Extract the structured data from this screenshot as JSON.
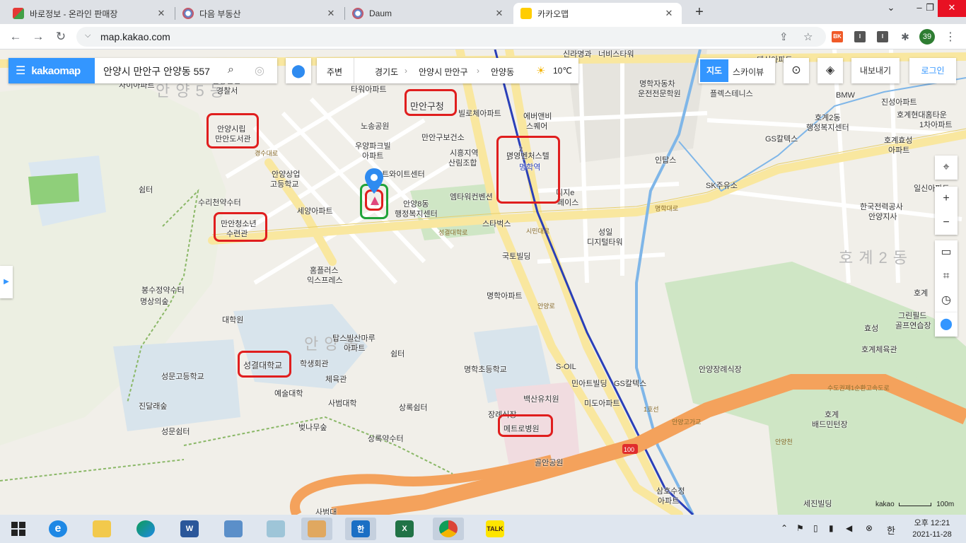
{
  "browser": {
    "tabs": [
      {
        "label": "바로정보 - 온라인 판매장",
        "close": "✕"
      },
      {
        "label": "다음 부동산",
        "close": "✕"
      },
      {
        "label": "Daum",
        "close": "✕"
      },
      {
        "label": "카카오맵",
        "close": "✕"
      }
    ],
    "new_tab": "+",
    "url": "map.kakao.com",
    "profile_badge": "39",
    "extensions": [
      "BK",
      "I",
      "I"
    ]
  },
  "mapui": {
    "brand": "kakaomap",
    "search_query": "안양시 만안구 안양동 557",
    "nearby_label": "주변",
    "breadcrumb": [
      "경기도",
      "안양시 만안구",
      "안양동"
    ],
    "temperature": "10℃",
    "maptype_map": "지도",
    "maptype_sky": "스카이뷰",
    "export_label": "내보내기",
    "login_label": "로그인",
    "scale_label": "kakao",
    "scale_distance": "100m",
    "icons": [
      "menu-icon",
      "search-icon",
      "check-icon",
      "location-pin-icon",
      "sun-icon",
      "layers-icon",
      "crosshair-icon",
      "zoom-in-icon",
      "zoom-out-icon",
      "ruler-icon",
      "area-icon",
      "compass-icon"
    ]
  },
  "map_labels": {
    "districts": [
      "안양5동",
      "안양동",
      "호계2동"
    ],
    "places": [
      "신라명과",
      "너비스타워",
      "대신아파트",
      "자이아파트",
      "안양만안",
      "경찰서",
      "명학자동차",
      "운전전문학원",
      "플렉스테니스",
      "BMW",
      "진성아파트",
      "만안구청",
      "안양시립",
      "만안도서관",
      "빌로체아파트",
      "노송공원",
      "타워아파트",
      "에버앤비",
      "스퀘어",
      "호계2동",
      "행정복지센터",
      "호계현대홈타운",
      "1차아파트",
      "만안구보건소",
      "시흥지역",
      "산림조합",
      "우양파크빌",
      "아파트",
      "GS칼텍스",
      "호계효성",
      "아파트",
      "명영벤처스텔",
      "인탑스",
      "안양상업",
      "고등학교",
      "쉼터",
      "SK주유소",
      "일신아파트",
      "수리천약수터",
      "트와이트센터",
      "디지e",
      "페이스",
      "안양8동",
      "행정복지센터",
      "엠타워컨벤션",
      "한국전력공사",
      "안양지사",
      "만안청소년",
      "수련관",
      "세양아파트",
      "스타벅스",
      "성일",
      "디지털타워",
      "국토빌딩",
      "홈플러스",
      "익스프레스",
      "봉수정약수터",
      "명상의숲",
      "명학아파트",
      "호계",
      "대학원",
      "탑스빌산마루",
      "아파트",
      "쉼터",
      "효성",
      "그린필드",
      "골프연습장",
      "호계체육관",
      "성결대학교",
      "학생회관",
      "성문고등학교",
      "명학초등학교",
      "S-OIL",
      "안양장례식장",
      "체육관",
      "예술대학",
      "민아트빌딩",
      "GS칼텍스",
      "백산유치원",
      "미도아파트",
      "진달래숲",
      "사범대학",
      "상록쉼터",
      "장례식장",
      "메트로병원",
      "성문쉼터",
      "벚나무숲",
      "상록약수터",
      "골안공원",
      "삼호수정",
      "아파트",
      "세진빌딩",
      "사범대",
      "호계",
      "배드민턴장"
    ],
    "roads": [
      "명학대로",
      "시민대로",
      "안양로",
      "성결대학로",
      "수도권제1순환고속도로",
      "안양고가교",
      "안양천",
      "1호선",
      "경수대로"
    ],
    "line_labels": [
      "명학역",
      "1",
      "2",
      "100"
    ]
  },
  "taskbar": {
    "apps": [
      "windows-start",
      "internet-explorer",
      "file-explorer",
      "edge",
      "word",
      "network-manager",
      "notepad",
      "paint",
      "hangul",
      "excel",
      "chrome",
      "kakaotalk"
    ],
    "ime": "한",
    "time": "오후 12:21",
    "date": "2021-11-28"
  }
}
